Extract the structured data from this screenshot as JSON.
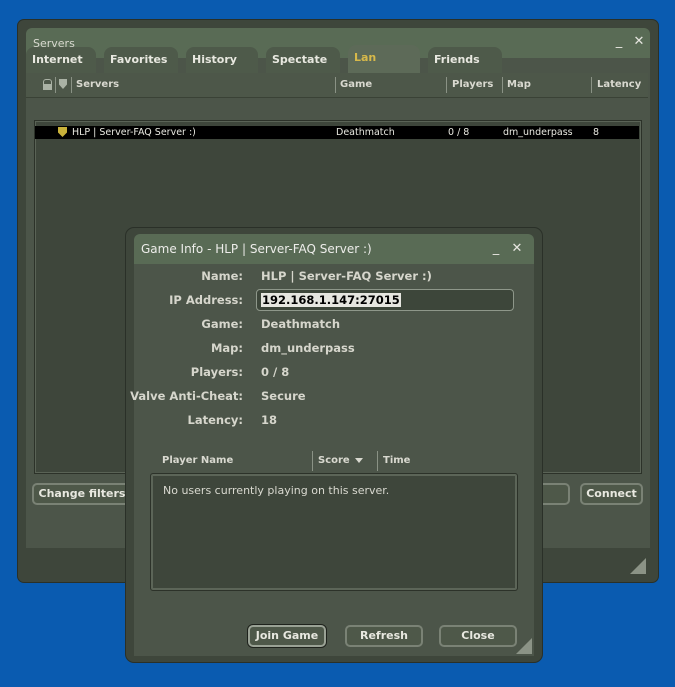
{
  "servers_window": {
    "title": "Servers",
    "tabs": [
      {
        "label": "Internet"
      },
      {
        "label": "Favorites"
      },
      {
        "label": "History"
      },
      {
        "label": "Spectate"
      },
      {
        "label": "Lan"
      },
      {
        "label": "Friends"
      }
    ],
    "active_tab": "Lan",
    "columns": [
      "Servers",
      "Game",
      "Players",
      "Map",
      "Latency"
    ],
    "rows": [
      {
        "name": "HLP | Server-FAQ Server :)",
        "game": "Deathmatch",
        "players": "0 / 8",
        "map": "dm_underpass",
        "latency": "8"
      }
    ],
    "buttons": {
      "change_filters": "Change filters",
      "connect": "Connect"
    }
  },
  "game_info": {
    "title": "Game Info - HLP | Server-FAQ Server :)",
    "fields": {
      "name_label": "Name:",
      "name_value": "HLP | Server-FAQ Server :)",
      "ip_label": "IP Address:",
      "ip_value": "192.168.1.147:27015",
      "game_label": "Game:",
      "game_value": "Deathmatch",
      "map_label": "Map:",
      "map_value": "dm_underpass",
      "players_label": "Players:",
      "players_value": "0 / 8",
      "vac_label": "Valve Anti-Cheat:",
      "vac_value": "Secure",
      "latency_label": "Latency:",
      "latency_value": "18"
    },
    "player_columns": {
      "name": "Player Name",
      "score": "Score",
      "time": "Time"
    },
    "empty_message": "No users currently playing on this server.",
    "buttons": {
      "join": "Join Game",
      "refresh": "Refresh",
      "close": "Close"
    }
  },
  "colors": {
    "desktop": "#0a5bb0",
    "title_bar": "#596b55",
    "panel": "#4c5549",
    "active_tab_text": "#d7b94a",
    "selected_row": "#000000"
  }
}
